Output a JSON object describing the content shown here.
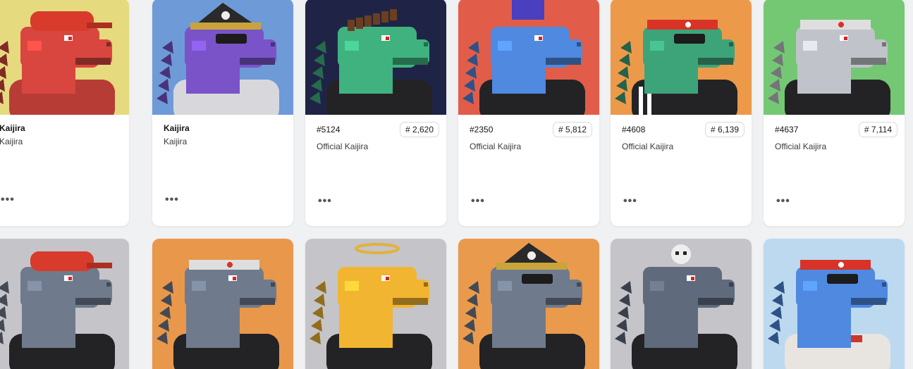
{
  "row1": [
    {
      "title": "Kaijira",
      "collection": "Kaijira",
      "bg": "#e5da7e",
      "body": "#d9463f",
      "hat": "cap",
      "hat_color": "#d83b2c",
      "top": "muscle"
    },
    {
      "title": "Kaijira",
      "collection": "Kaijira",
      "bg": "#6e9ad8",
      "body": "#7a53c9",
      "hat": "pirate",
      "hat_color": "#2a2a2a",
      "top": "robe"
    },
    {
      "id": "#5124",
      "rank": "# 2,620",
      "collection": "Official Kaijira",
      "bg": "#1f2447",
      "body": "#3fb27f",
      "hat": "none",
      "hat_color": "#6a3f20",
      "top": "hoodie"
    },
    {
      "id": "#2350",
      "rank": "# 5,812",
      "collection": "Official Kaijira",
      "bg": "#e15d49",
      "body": "#4f89e0",
      "hat": "crown",
      "hat_color": "#4a3fbf",
      "top": "hoodie"
    },
    {
      "id": "#4608",
      "rank": "# 6,139",
      "collection": "Official Kaijira",
      "bg": "#ec9a4a",
      "body": "#3da47a",
      "hat": "bandana",
      "hat_color": "#d93328",
      "top": "track"
    },
    {
      "id": "#4637",
      "rank": "# 7,114",
      "collection": "Official Kaijira",
      "bg": "#74c874",
      "body": "#c0c3c9",
      "hat": "bandana",
      "hat_color": "#dedede",
      "top": "hoodie"
    }
  ],
  "row2": [
    {
      "bg": "#c4c4c9",
      "body": "#6f7b8d",
      "hat": "cap",
      "hat_color": "#d83b2c",
      "top": "suit"
    },
    {
      "bg": "#e9974b",
      "body": "#6f7b8d",
      "hat": "bandana",
      "hat_color": "#dedede",
      "top": "hoodie"
    },
    {
      "bg": "#c4c4c9",
      "body": "#f2b531",
      "hat": "halo",
      "hat_color": "#e2b23a",
      "top": "hoodie"
    },
    {
      "bg": "#ea9a4c",
      "body": "#6f7b8d",
      "hat": "pirate",
      "hat_color": "#2a2a2a",
      "top": "hoodie"
    },
    {
      "bg": "#c4c4c9",
      "body": "#5f6b7d",
      "hat": "skull",
      "hat_color": "#eeeeee",
      "top": "hoodie"
    },
    {
      "bg": "#bcd9ef",
      "body": "#4f89e0",
      "hat": "bandana",
      "hat_color": "#d93328",
      "top": "scarf"
    }
  ],
  "more_label": "•••"
}
